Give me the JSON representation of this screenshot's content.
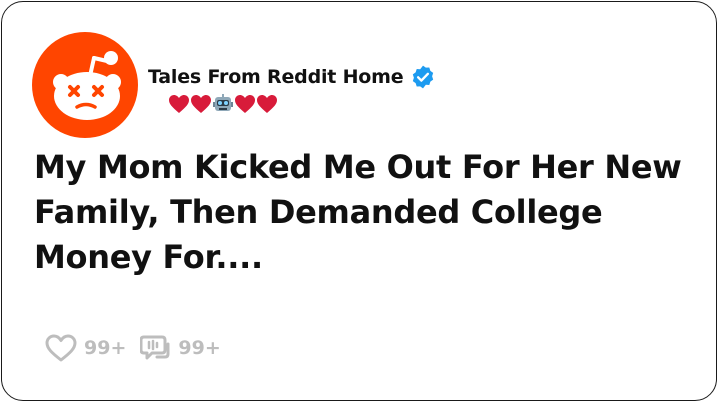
{
  "post": {
    "account_name": "Tales From Reddit Home",
    "verified": true,
    "bio_emojis": [
      "heart",
      "heart",
      "robot",
      "heart",
      "heart"
    ],
    "title": "My Mom Kicked Me Out For Her New Family, Then Demanded College Money For....",
    "likes_count": "99+",
    "comments_count": "99+"
  },
  "colors": {
    "brand": "#ff4500",
    "verified": "#1d9bf0",
    "heart": "#d81b3a",
    "muted": "#bdbdbd"
  },
  "icons": {
    "avatar": "reddit-snoo-dizzy-icon",
    "verified": "verified-badge-icon",
    "like": "heart-outline-icon",
    "comment": "comment-bubble-icon"
  }
}
